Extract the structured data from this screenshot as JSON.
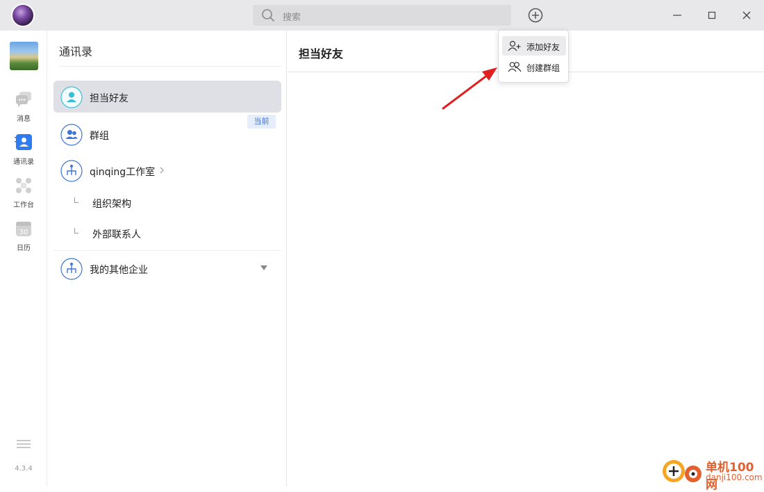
{
  "titlebar": {
    "search_placeholder": "搜索"
  },
  "leftbar": {
    "nav": [
      {
        "label": "消息",
        "icon": "message-icon"
      },
      {
        "label": "通讯录",
        "icon": "contacts-icon"
      },
      {
        "label": "工作台",
        "icon": "workbench-icon"
      },
      {
        "label": "日历",
        "icon": "calendar-icon",
        "day": "30"
      }
    ],
    "version": "4.3.4"
  },
  "contacts": {
    "title": "通讯录",
    "items": [
      {
        "label": "担当好友"
      },
      {
        "label": "群组"
      },
      {
        "label": "qinqing工作室"
      },
      {
        "label": "我的其他企业"
      }
    ],
    "current_badge": "当前",
    "sub_items": [
      {
        "label": "组织架构"
      },
      {
        "label": "外部联系人"
      }
    ]
  },
  "main": {
    "title": "担当好友"
  },
  "dropdown": {
    "items": [
      {
        "label": "添加好友"
      },
      {
        "label": "创建群组"
      }
    ]
  },
  "watermark": {
    "name": "单机100网",
    "url": "danji100.com"
  },
  "colors": {
    "accent": "#3d74d8",
    "nav_active": "#2f7bf0",
    "arrow": "#e02020"
  }
}
